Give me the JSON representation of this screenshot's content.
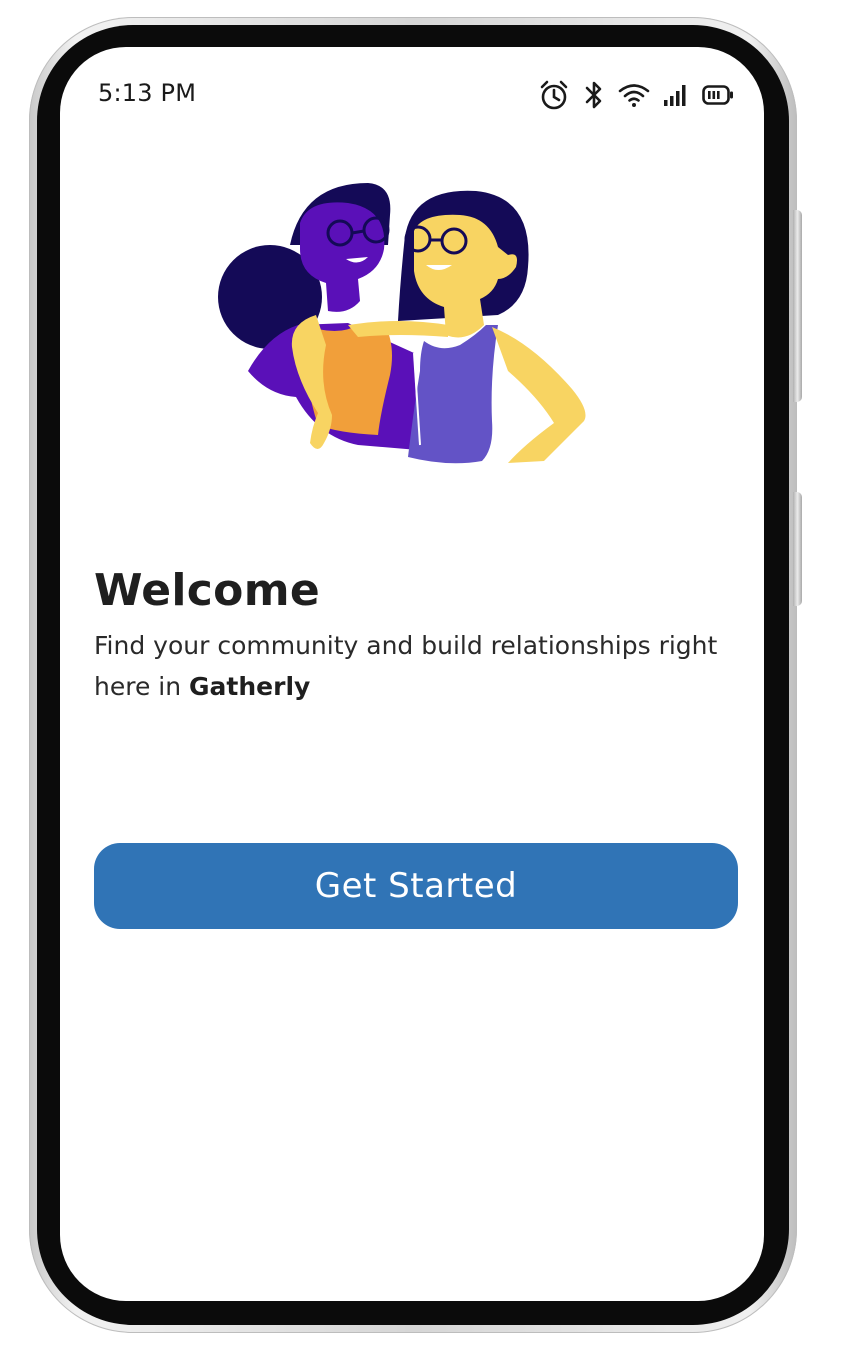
{
  "status_bar": {
    "time": "5:13 PM",
    "icons": [
      "alarm-icon",
      "bluetooth-icon",
      "wifi-icon",
      "signal-icon",
      "battery-icon"
    ]
  },
  "hero": {
    "illustration": "two-friends-illustration"
  },
  "welcome": {
    "title": "Welcome",
    "subtitle_text": "Find your community and build relationships right here in ",
    "brand_name": "Gatherly"
  },
  "actions": {
    "get_started_label": "Get Started"
  },
  "colors": {
    "primary_button": "#3074b6",
    "text_dark": "#1f1f1f",
    "purple_dark": "#140a57",
    "purple": "#5a10b8",
    "orange": "#f19f3a",
    "yellow": "#f8d462",
    "lavender": "#6353c6"
  }
}
